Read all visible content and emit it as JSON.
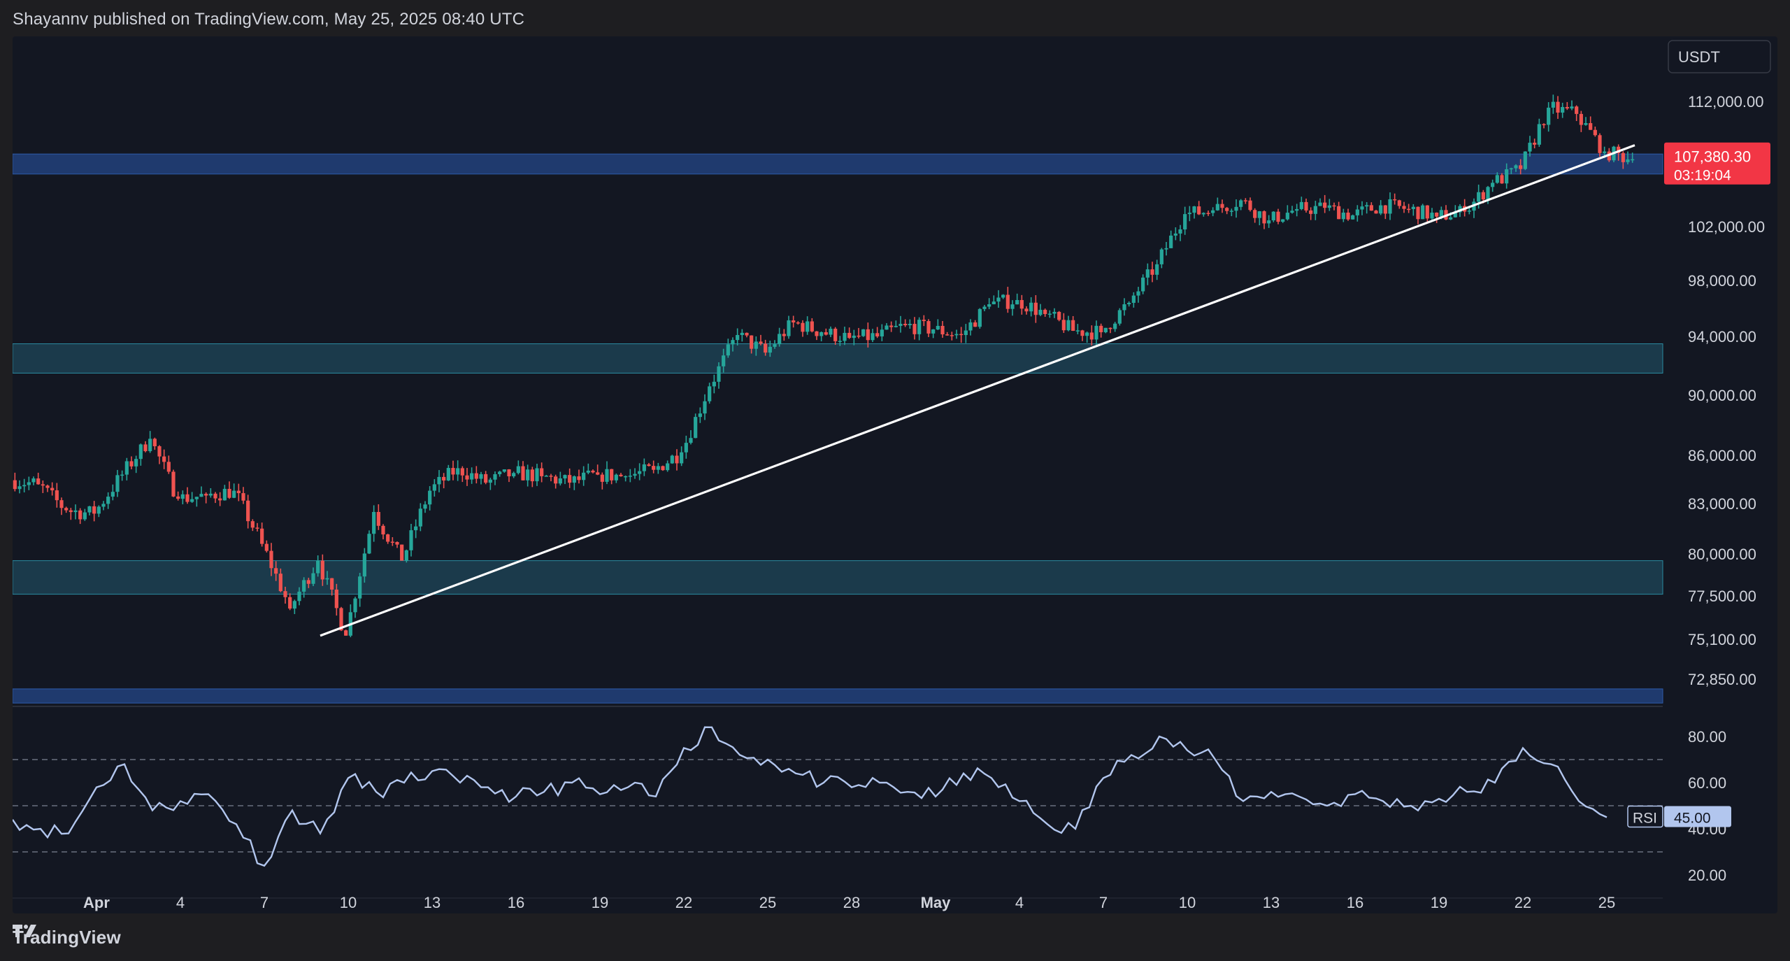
{
  "header": {
    "publisher": "Shayannv published on TradingView.com, May 25, 2025 08:40 UTC"
  },
  "footer": {
    "brand": "TradingView"
  },
  "currency_badge": "USDT",
  "price_label": {
    "price": "107,380.30",
    "countdown": "03:19:04"
  },
  "rsi_label": {
    "name": "RSI",
    "value": "45.00"
  },
  "colors": {
    "background": "#131722",
    "up": "#26a69a",
    "down": "#ef5350",
    "zone_dark_blue": "#1f3a6e",
    "zone_teal": "#1b3a4b",
    "trendline": "#ffffff",
    "rsi_line": "#b2c6ee",
    "price_label_bg": "#f23645"
  },
  "chart_data": [
    {
      "type": "candlestick",
      "timeframe": "4h",
      "price_axis_labels": [
        "112,000.00",
        "102,000.00",
        "98,000.00",
        "94,000.00",
        "90,000.00",
        "86,000.00",
        "83,000.00",
        "80,000.00",
        "77,500.00",
        "75,100.00",
        "72,850.00"
      ],
      "price_axis_values": [
        112000,
        102000,
        98000,
        94000,
        90000,
        86000,
        83000,
        80000,
        77500,
        75100,
        72850
      ],
      "time_axis_labels": [
        "Apr",
        "4",
        "7",
        "10",
        "13",
        "16",
        "19",
        "22",
        "25",
        "28",
        "May",
        "4",
        "7",
        "10",
        "13",
        "16",
        "19",
        "22",
        "25"
      ],
      "time_axis_dates": [
        "2025-04-01",
        "2025-04-04",
        "2025-04-07",
        "2025-04-10",
        "2025-04-13",
        "2025-04-16",
        "2025-04-19",
        "2025-04-22",
        "2025-04-25",
        "2025-04-28",
        "2025-05-01",
        "2025-05-04",
        "2025-05-07",
        "2025-05-10",
        "2025-05-13",
        "2025-05-16",
        "2025-05-19",
        "2025-05-22",
        "2025-05-25"
      ],
      "x_range": [
        "2025-03-29",
        "2025-05-27"
      ],
      "last_price": 107380.3,
      "close_series": [
        {
          "x": "2025-03-29",
          "y": 84200
        },
        {
          "x": "2025-03-30",
          "y": 82600
        },
        {
          "x": "2025-03-31",
          "y": 82400
        },
        {
          "x": "2025-04-01",
          "y": 84800
        },
        {
          "x": "2025-04-02",
          "y": 87100
        },
        {
          "x": "2025-04-03",
          "y": 83300
        },
        {
          "x": "2025-04-04",
          "y": 83500
        },
        {
          "x": "2025-04-05",
          "y": 83800
        },
        {
          "x": "2025-04-06",
          "y": 80600
        },
        {
          "x": "2025-04-07",
          "y": 76800
        },
        {
          "x": "2025-04-08",
          "y": 79600
        },
        {
          "x": "2025-04-09",
          "y": 75300
        },
        {
          "x": "2025-04-10",
          "y": 82500
        },
        {
          "x": "2025-04-11",
          "y": 79600
        },
        {
          "x": "2025-04-12",
          "y": 83800
        },
        {
          "x": "2025-04-13",
          "y": 85200
        },
        {
          "x": "2025-04-14",
          "y": 84300
        },
        {
          "x": "2025-04-15",
          "y": 84900
        },
        {
          "x": "2025-04-16",
          "y": 84700
        },
        {
          "x": "2025-04-17",
          "y": 84300
        },
        {
          "x": "2025-04-18",
          "y": 84800
        },
        {
          "x": "2025-04-19",
          "y": 84700
        },
        {
          "x": "2025-04-20",
          "y": 85100
        },
        {
          "x": "2025-04-21",
          "y": 86200
        },
        {
          "x": "2025-04-22",
          "y": 90600
        },
        {
          "x": "2025-04-23",
          "y": 94100
        },
        {
          "x": "2025-04-24",
          "y": 92900
        },
        {
          "x": "2025-04-25",
          "y": 95000
        },
        {
          "x": "2025-04-26",
          "y": 94300
        },
        {
          "x": "2025-04-27",
          "y": 93900
        },
        {
          "x": "2025-04-28",
          "y": 94000
        },
        {
          "x": "2025-04-29",
          "y": 94800
        },
        {
          "x": "2025-04-30",
          "y": 94500
        },
        {
          "x": "2025-05-01",
          "y": 94100
        },
        {
          "x": "2025-05-02",
          "y": 96300
        },
        {
          "x": "2025-05-03",
          "y": 96600
        },
        {
          "x": "2025-05-04",
          "y": 95600
        },
        {
          "x": "2025-05-05",
          "y": 94400
        },
        {
          "x": "2025-05-06",
          "y": 94300
        },
        {
          "x": "2025-05-07",
          "y": 96400
        },
        {
          "x": "2025-05-08",
          "y": 99200
        },
        {
          "x": "2025-05-09",
          "y": 103000
        },
        {
          "x": "2025-05-10",
          "y": 103300
        },
        {
          "x": "2025-05-11",
          "y": 104100
        },
        {
          "x": "2025-05-12",
          "y": 102500
        },
        {
          "x": "2025-05-13",
          "y": 103400
        },
        {
          "x": "2025-05-14",
          "y": 103500
        },
        {
          "x": "2025-05-15",
          "y": 102900
        },
        {
          "x": "2025-05-16",
          "y": 103700
        },
        {
          "x": "2025-05-17",
          "y": 103400
        },
        {
          "x": "2025-05-18",
          "y": 102800
        },
        {
          "x": "2025-05-19",
          "y": 103200
        },
        {
          "x": "2025-05-20",
          "y": 105500
        },
        {
          "x": "2025-05-21",
          "y": 106600
        },
        {
          "x": "2025-05-22",
          "y": 111500
        },
        {
          "x": "2025-05-23",
          "y": 111000
        },
        {
          "x": "2025-05-24",
          "y": 108000
        },
        {
          "x": "2025-05-25",
          "y": 107380
        }
      ],
      "horizontal_zones": [
        {
          "low": 106200,
          "high": 107800,
          "color": "dark_blue"
        },
        {
          "low": 91500,
          "high": 93500,
          "color": "teal"
        },
        {
          "low": 77600,
          "high": 79600,
          "color": "teal"
        },
        {
          "low": 71500,
          "high": 72300,
          "color": "dark_blue"
        }
      ],
      "trendline": {
        "from": {
          "x": "2025-04-09",
          "y": 75300
        },
        "to": {
          "x": "2025-05-26",
          "y": 108500
        }
      }
    },
    {
      "type": "line",
      "title": "RSI",
      "axis_labels": [
        "80.00",
        "60.00",
        "40.00",
        "20.00"
      ],
      "axis_values": [
        80,
        60,
        40,
        20
      ],
      "reference_levels": [
        70,
        50,
        30
      ],
      "last_value": 45,
      "ylim": [
        10,
        90
      ],
      "series": [
        {
          "x": "2025-03-29",
          "y": 44
        },
        {
          "x": "2025-03-30",
          "y": 40
        },
        {
          "x": "2025-03-31",
          "y": 38
        },
        {
          "x": "2025-04-01",
          "y": 58
        },
        {
          "x": "2025-04-02",
          "y": 68
        },
        {
          "x": "2025-04-03",
          "y": 48
        },
        {
          "x": "2025-04-04",
          "y": 52
        },
        {
          "x": "2025-04-05",
          "y": 55
        },
        {
          "x": "2025-04-06",
          "y": 42
        },
        {
          "x": "2025-04-07",
          "y": 24
        },
        {
          "x": "2025-04-08",
          "y": 48
        },
        {
          "x": "2025-04-09",
          "y": 38
        },
        {
          "x": "2025-04-10",
          "y": 62
        },
        {
          "x": "2025-04-11",
          "y": 56
        },
        {
          "x": "2025-04-12",
          "y": 60
        },
        {
          "x": "2025-04-13",
          "y": 65
        },
        {
          "x": "2025-04-14",
          "y": 60
        },
        {
          "x": "2025-04-15",
          "y": 58
        },
        {
          "x": "2025-04-16",
          "y": 54
        },
        {
          "x": "2025-04-17",
          "y": 56
        },
        {
          "x": "2025-04-18",
          "y": 60
        },
        {
          "x": "2025-04-19",
          "y": 55
        },
        {
          "x": "2025-04-20",
          "y": 58
        },
        {
          "x": "2025-04-21",
          "y": 54
        },
        {
          "x": "2025-04-22",
          "y": 75
        },
        {
          "x": "2025-04-23",
          "y": 84
        },
        {
          "x": "2025-04-24",
          "y": 72
        },
        {
          "x": "2025-04-25",
          "y": 70
        },
        {
          "x": "2025-04-26",
          "y": 64
        },
        {
          "x": "2025-04-27",
          "y": 60
        },
        {
          "x": "2025-04-28",
          "y": 58
        },
        {
          "x": "2025-04-29",
          "y": 60
        },
        {
          "x": "2025-04-30",
          "y": 56
        },
        {
          "x": "2025-05-01",
          "y": 54
        },
        {
          "x": "2025-05-02",
          "y": 64
        },
        {
          "x": "2025-05-03",
          "y": 62
        },
        {
          "x": "2025-05-04",
          "y": 52
        },
        {
          "x": "2025-05-05",
          "y": 42
        },
        {
          "x": "2025-05-06",
          "y": 40
        },
        {
          "x": "2025-05-07",
          "y": 62
        },
        {
          "x": "2025-05-08",
          "y": 72
        },
        {
          "x": "2025-05-09",
          "y": 80
        },
        {
          "x": "2025-05-10",
          "y": 74
        },
        {
          "x": "2025-05-11",
          "y": 70
        },
        {
          "x": "2025-05-12",
          "y": 52
        },
        {
          "x": "2025-05-13",
          "y": 56
        },
        {
          "x": "2025-05-14",
          "y": 54
        },
        {
          "x": "2025-05-15",
          "y": 50
        },
        {
          "x": "2025-05-16",
          "y": 55
        },
        {
          "x": "2025-05-17",
          "y": 52
        },
        {
          "x": "2025-05-18",
          "y": 50
        },
        {
          "x": "2025-05-19",
          "y": 53
        },
        {
          "x": "2025-05-20",
          "y": 56
        },
        {
          "x": "2025-05-21",
          "y": 60
        },
        {
          "x": "2025-05-22",
          "y": 75
        },
        {
          "x": "2025-05-23",
          "y": 68
        },
        {
          "x": "2025-05-24",
          "y": 52
        },
        {
          "x": "2025-05-25",
          "y": 45
        }
      ]
    }
  ]
}
